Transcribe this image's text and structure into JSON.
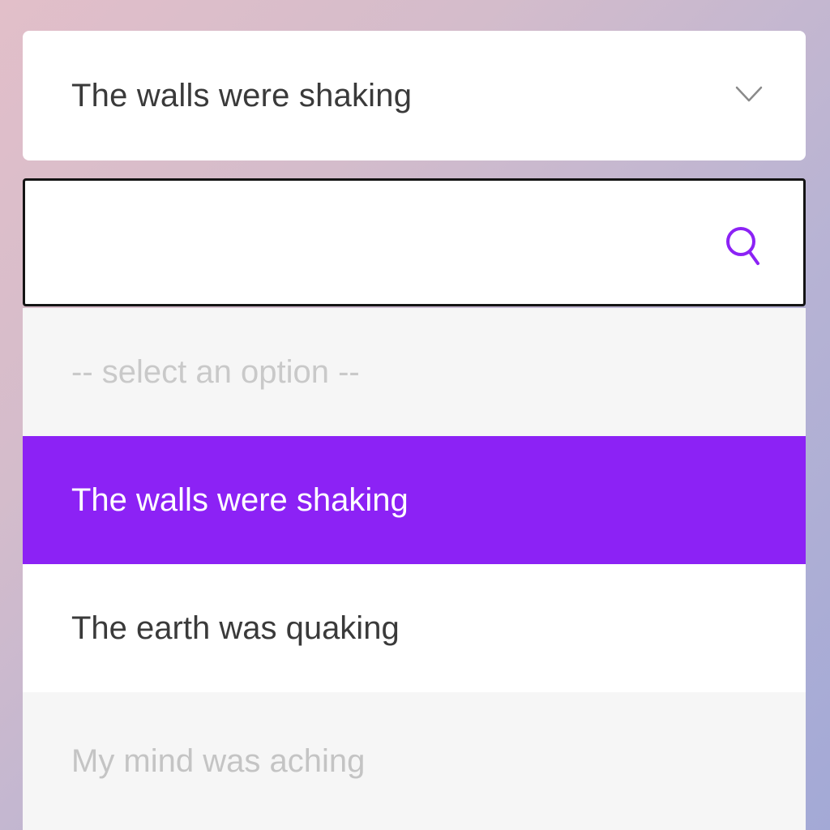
{
  "select": {
    "value": "The walls were shaking",
    "chevron_icon": "chevron-down-icon"
  },
  "search": {
    "value": "",
    "placeholder": "",
    "icon": "search-icon"
  },
  "options": [
    {
      "label": "-- select an option --",
      "state": "placeholder"
    },
    {
      "label": "The walls were shaking",
      "state": "selected"
    },
    {
      "label": "The earth was quaking",
      "state": "normal"
    },
    {
      "label": "My mind was aching",
      "state": "disabled"
    }
  ],
  "colors": {
    "accent": "#8c22f5",
    "search_icon": "#8c22f5",
    "text": "#3a3a3a",
    "muted_text": "#c9c9c9",
    "option_bg_muted": "#f6f6f6",
    "search_border": "#141414"
  }
}
